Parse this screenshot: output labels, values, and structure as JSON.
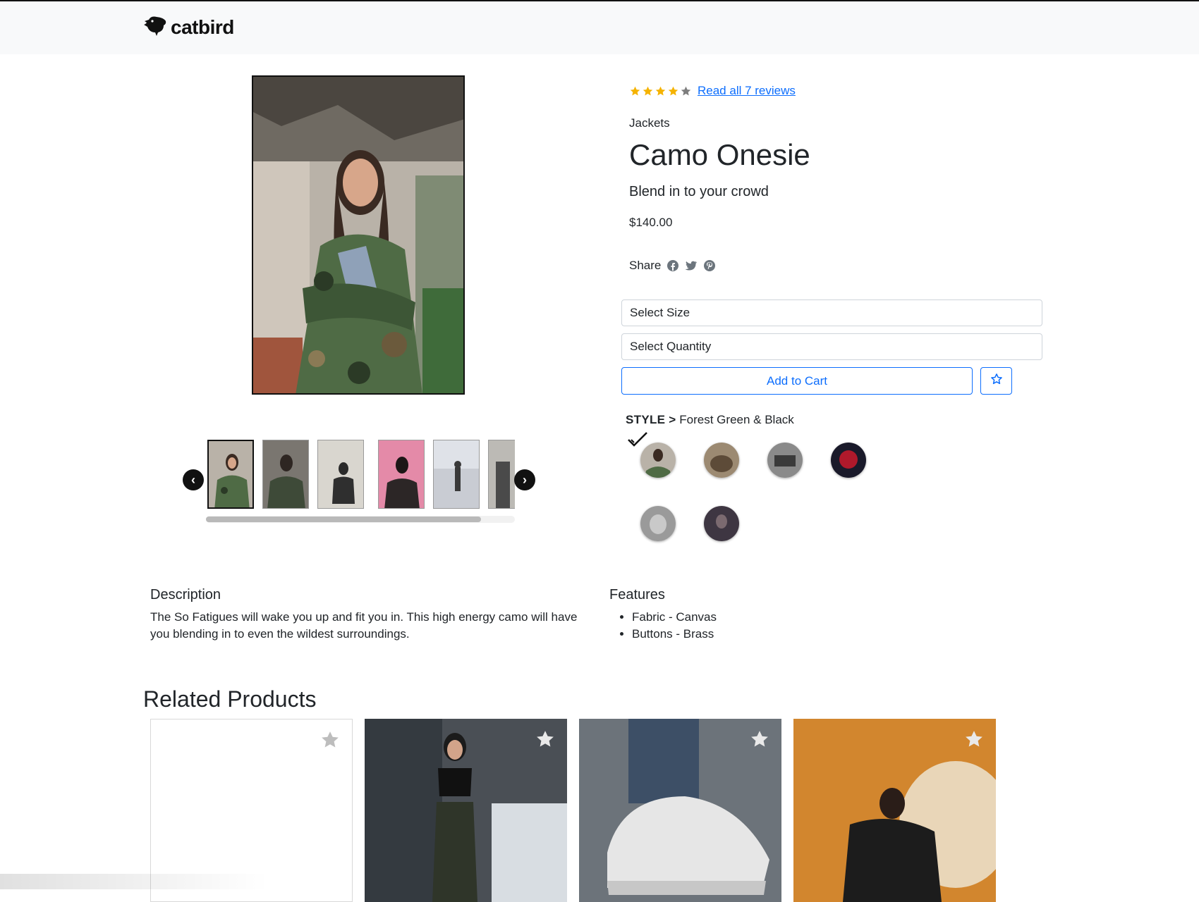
{
  "header": {
    "brand": "catbird",
    "logo_icon": "bird-logo-icon"
  },
  "gallery": {
    "thumbnail_count": 6,
    "selected_thumbnail": 1,
    "prev_icon": "chevron-left-icon",
    "next_icon": "chevron-right-icon"
  },
  "product": {
    "rating": 4,
    "rating_max": 5,
    "reviews_link": "Read all 7 reviews",
    "category": "Jackets",
    "name": "Camo Onesie",
    "slogan": "Blend in to your crowd",
    "price": "$140.00",
    "share_label": "Share",
    "share_icons": [
      "facebook-icon",
      "twitter-icon",
      "pinterest-icon"
    ]
  },
  "form": {
    "size_select": "Select Size",
    "quantity_select": "Select Quantity",
    "add_to_cart": "Add to Cart",
    "favorite_icon": "star-outline-icon"
  },
  "style": {
    "label": "STYLE >",
    "selected_name": "Forest Green & Black",
    "swatch_count": 6,
    "selected_swatch": 1
  },
  "description": {
    "heading": "Description",
    "text": "The So Fatigues will wake you up and fit you in. This high energy camo will have you blending in to even the wildest surroundings."
  },
  "features": {
    "heading": "Features",
    "items": [
      "Fabric - Canvas",
      "Buttons - Brass"
    ]
  },
  "related": {
    "heading": "Related Products",
    "card_count": 4,
    "star_icon": "star-icon"
  },
  "colors": {
    "link_blue": "#0d6efd",
    "star_gold": "#f5b301",
    "star_gray": "#7d7d7d",
    "header_bg": "#f8f9fa"
  }
}
